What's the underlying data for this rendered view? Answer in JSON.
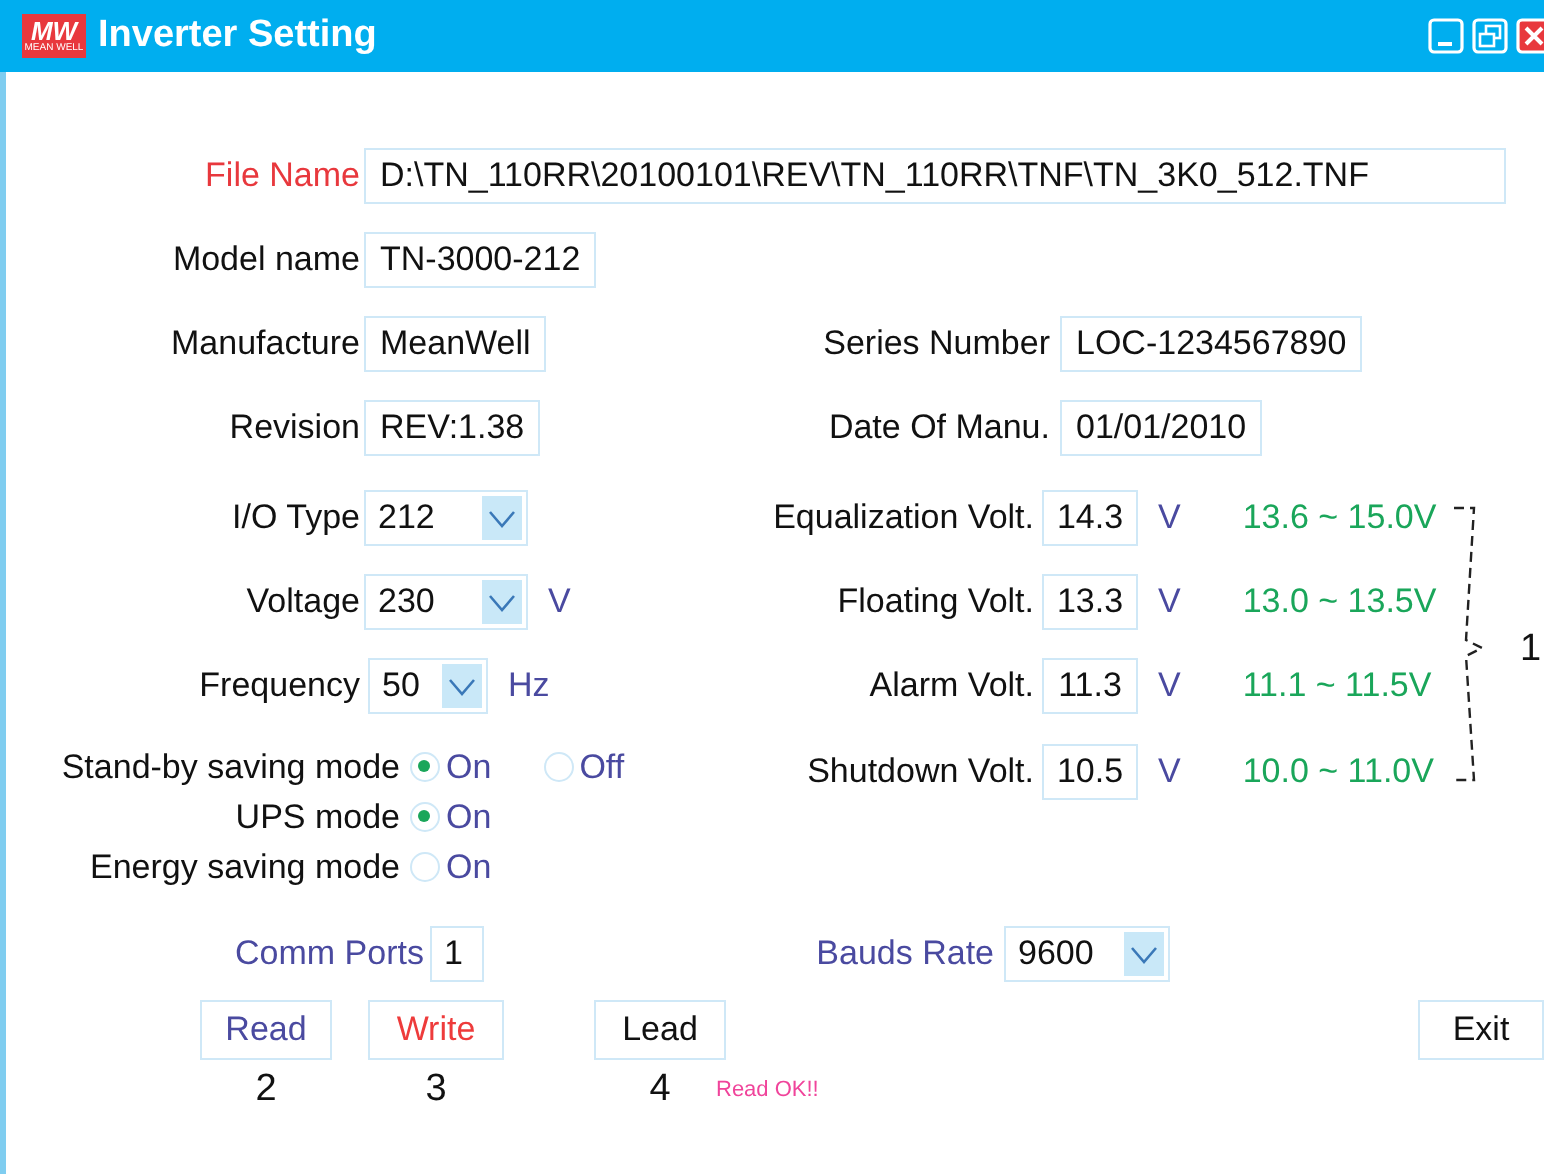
{
  "window": {
    "title": "Inverter Setting",
    "logo": "MW",
    "logo_sub": "MEAN WELL"
  },
  "file_name": {
    "label": "File Name",
    "value": "D:\\TN_110RR\\20100101\\REV\\TN_110RR\\TNF\\TN_3K0_512.TNF"
  },
  "device_rows": [
    {
      "left": {
        "label": "Model name",
        "value": "TN-3000-212"
      }
    },
    {
      "left": {
        "label": "Manufacture",
        "value": "MeanWell"
      },
      "right": {
        "label": "Series Number",
        "value": "LOC-1234567890"
      }
    },
    {
      "left": {
        "label": "Revision",
        "value": "REV:1.38"
      },
      "right": {
        "label": "Date Of Manu.",
        "value": "01/01/2010"
      }
    }
  ],
  "selects": [
    {
      "label": "I/O Type",
      "value": "212"
    },
    {
      "label": "Voltage",
      "value": "230",
      "unit": "V"
    },
    {
      "label": "Frequency",
      "value": "50",
      "unit": "Hz"
    }
  ],
  "modes": [
    {
      "label": "Stand-by saving mode",
      "options": [
        {
          "label": "On",
          "selected": true
        },
        {
          "label": "Off",
          "selected": false
        }
      ]
    },
    {
      "label": "UPS mode",
      "options": [
        {
          "label": "On",
          "selected": true
        }
      ]
    },
    {
      "label": "Energy saving mode",
      "options": [
        {
          "label": "On",
          "selected": false
        }
      ]
    }
  ],
  "voltages": [
    {
      "label": "Equalization Volt.",
      "value": "14.3",
      "unit": "V",
      "range": "13.6 ~ 15.0V"
    },
    {
      "label": "Floating Volt.",
      "value": "13.3",
      "unit": "V",
      "range": "13.0 ~ 13.5V"
    },
    {
      "label": "Alarm Volt.",
      "value": "11.3",
      "unit": "V",
      "range": "11.1 ~ 11.5V"
    },
    {
      "label": "Shutdown Volt.",
      "value": "10.5",
      "unit": "V",
      "range": "10.0 ~ 11.0V"
    }
  ],
  "voltages_callout": "1",
  "comm_ports": {
    "label": "Comm Ports",
    "value": "1"
  },
  "bauds_rate": {
    "label": "Bauds Rate",
    "value": "9600"
  },
  "buttons": [
    {
      "label": "Read",
      "color": "#4a4aa0",
      "callout": "2"
    },
    {
      "label": "Write",
      "color": "#ee3b3b",
      "callout": "3"
    },
    {
      "label": "Lead",
      "color": "#111111",
      "callout": "4"
    }
  ],
  "status": "Read OK!!",
  "exit_button": {
    "label": "Exit"
  }
}
